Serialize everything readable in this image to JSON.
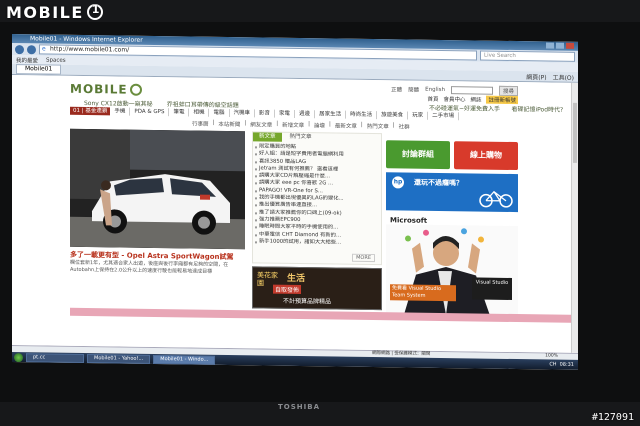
{
  "watermark": {
    "logo": "MOBILE",
    "id": "#127091"
  },
  "monitor": {
    "brand": "TOSHIBA"
  },
  "browser": {
    "window_title": "Mobile01 - Windows Internet Explorer",
    "address": "http://www.mobile01.com/",
    "search_placeholder": "Live Search",
    "toolbar": {
      "spaces": "Spaces",
      "favorites": "我的最愛"
    },
    "tab": "Mobile01",
    "tabbar_right": [
      "網頁(P)",
      "工具(O)"
    ],
    "status_text": "網際網路 | 受保護模式：關閉",
    "zoom": "100%"
  },
  "site": {
    "logo": "MOBILE",
    "top_links": [
      "正體",
      "簡體",
      "English",
      "搜尋"
    ],
    "user_links": [
      "首頁",
      "會員中心",
      "網誌",
      "註冊新帳號"
    ],
    "news": [
      "Sony CX12啟動一窺其秘",
      "乔祖蚌口耳帶傳的級空話題"
    ],
    "news_right": [
      "不必碰運氣~好運免費入手",
      "看碟記憶iPod時代?"
    ],
    "menu": {
      "current": "01 | 基金連鎖",
      "items": [
        "手機",
        "PDA & GPS",
        "筆電",
        "相機",
        "電腦",
        "汽機車",
        "影音",
        "家電",
        "週邊",
        "居家生活",
        "時尚生活",
        "旅遊美食",
        "玩家",
        "二手市場"
      ]
    },
    "sub_menu": [
      "行事曆",
      "本站新聞",
      "網友文章",
      "新增文章",
      "論壇",
      "最新文章",
      "熱門文章",
      "社群"
    ],
    "hero": {
      "caption": "多了一載更有型 - Opel Astra SportWagon試駕",
      "desc": "欄位套新1年，尤其適合家人出遊，後座與後行李廂都有足夠的空間，在Autobahn上保持在2.0公升以上的速度行駛也能輕易地達成目標"
    },
    "list": {
      "tabs": [
        "新文章",
        "熱門文章"
      ],
      "items": [
        "限定購買的地點",
        "好人組：請是短字費用者電腦網利用",
        "喜訊3850 贈品LAG",
        "Jetram 測試有何推薦？ 選看這裡",
        "請購大家CD片解壓縮是什麼...",
        "請購大家 eee pc 你喜歡 2G ...",
        "PAPAGO! VR-One for S...",
        "我的手機都出現優異的LAG的變化...",
        "推出優質廣告串連直接...",
        "推了請大家推薦你的口碑上(09-ok)",
        "強力推薦EPC900",
        "睡眠時間大家平時的手機使用的...",
        "中華電信 CHT Diamond 有新的...",
        "新手1000的試用，諸如大大給些..."
      ],
      "more": "MORE"
    },
    "banner": {
      "side": "美花家園",
      "title": "生活",
      "tag": "自取發佈",
      "line": "不計預算品牌精品"
    },
    "btn_forum": "討論群組",
    "btn_shop": "線上購物",
    "ad_ipod": {
      "brand": "hp",
      "text": "還玩不過癮嗎？"
    },
    "ad_ms": {
      "brand": "Microsoft",
      "caption": "免費看 Visual Studio Team System",
      "product": "Visual Studio"
    }
  },
  "taskbar": {
    "items": [
      "pt.cc",
      "Mobile01 - Yahoo!...",
      "Mobile01 - Windo..."
    ],
    "tray": "CH",
    "clock": "08:31"
  }
}
